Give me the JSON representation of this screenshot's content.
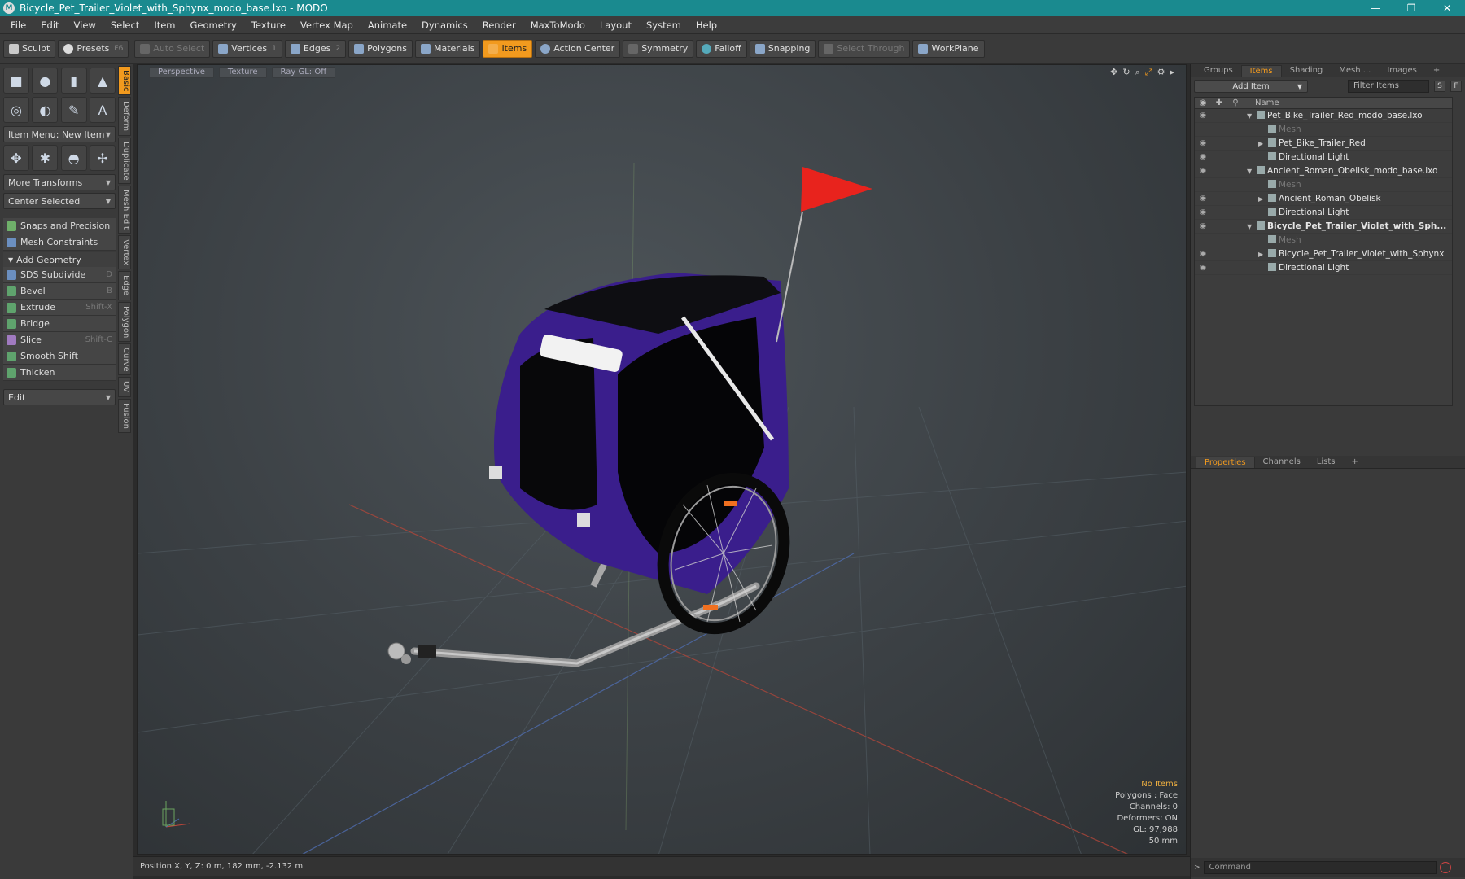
{
  "window": {
    "title": "Bicycle_Pet_Trailer_Violet_with_Sphynx_modo_base.lxo - MODO",
    "min": "—",
    "max": "❐",
    "close": "✕"
  },
  "menu": [
    "File",
    "Edit",
    "View",
    "Select",
    "Item",
    "Geometry",
    "Texture",
    "Vertex Map",
    "Animate",
    "Dynamics",
    "Render",
    "MaxToModo",
    "Layout",
    "System",
    "Help"
  ],
  "toolbar": {
    "sculpt": "Sculpt",
    "presets": "Presets",
    "presets_sc": "F6",
    "auto_select": "Auto Select",
    "vertices": "Vertices",
    "vertices_sc": "1",
    "edges": "Edges",
    "edges_sc": "2",
    "polygons": "Polygons",
    "materials": "Materials",
    "items": "Items",
    "action_center": "Action Center",
    "symmetry": "Symmetry",
    "falloff": "Falloff",
    "snapping": "Snapping",
    "select_through": "Select Through",
    "workplane": "WorkPlane"
  },
  "left": {
    "item_menu": "Item Menu: New Item",
    "more_transforms": "More Transforms",
    "center_selected": "Center Selected",
    "snaps": "Snaps and Precision",
    "mesh_constraints": "Mesh Constraints",
    "add_geometry": "Add Geometry",
    "tools": [
      {
        "label": "SDS Subdivide",
        "sc": "D"
      },
      {
        "label": "Bevel",
        "sc": "B"
      },
      {
        "label": "Extrude",
        "sc": "Shift-X"
      },
      {
        "label": "Bridge",
        "sc": ""
      },
      {
        "label": "Slice",
        "sc": "Shift-C"
      },
      {
        "label": "Smooth Shift",
        "sc": ""
      },
      {
        "label": "Thicken",
        "sc": ""
      }
    ],
    "edit": "Edit",
    "vtabs": [
      "Basic",
      "Deform",
      "Duplicate",
      "Mesh Edit",
      "Vertex",
      "Edge",
      "Polygon",
      "Curve",
      "UV",
      "Fusion"
    ]
  },
  "viewport": {
    "tabs": [
      "Perspective",
      "Texture",
      "Ray GL: Off"
    ],
    "info": {
      "selection": "No Items",
      "polygons": "Polygons : Face",
      "channels": "Channels: 0",
      "deformers": "Deformers: ON",
      "gl": "GL: 97,988",
      "scale": "50 mm"
    }
  },
  "status": {
    "position": "Position X, Y, Z:   0 m, 182 mm, -2.132 m"
  },
  "right": {
    "tabs": [
      "Groups",
      "Items",
      "Shading",
      "Mesh ...",
      "Images",
      "+"
    ],
    "add_item": "Add Item",
    "filter_items": "Filter Items",
    "s_btn": "S",
    "f_btn": "F",
    "name_col": "Name",
    "items": [
      {
        "label": "Pet_Bike_Trailer_Red_modo_base.lxo",
        "indent": 0,
        "exp": "▼",
        "dim": false,
        "bold": false
      },
      {
        "label": "Mesh",
        "indent": 1,
        "exp": "",
        "dim": true,
        "bold": false
      },
      {
        "label": "Pet_Bike_Trailer_Red",
        "indent": 1,
        "exp": "▶",
        "dim": false,
        "bold": false
      },
      {
        "label": "Directional Light",
        "indent": 1,
        "exp": "",
        "dim": false,
        "bold": false
      },
      {
        "label": "Ancient_Roman_Obelisk_modo_base.lxo",
        "indent": 0,
        "exp": "▼",
        "dim": false,
        "bold": false
      },
      {
        "label": "Mesh",
        "indent": 1,
        "exp": "",
        "dim": true,
        "bold": false
      },
      {
        "label": "Ancient_Roman_Obelisk",
        "indent": 1,
        "exp": "▶",
        "dim": false,
        "bold": false
      },
      {
        "label": "Directional Light",
        "indent": 1,
        "exp": "",
        "dim": false,
        "bold": false
      },
      {
        "label": "Bicycle_Pet_Trailer_Violet_with_Sph...",
        "indent": 0,
        "exp": "▼",
        "dim": false,
        "bold": true
      },
      {
        "label": "Mesh",
        "indent": 1,
        "exp": "",
        "dim": true,
        "bold": false
      },
      {
        "label": "Bicycle_Pet_Trailer_Violet_with_Sphynx",
        "indent": 1,
        "exp": "▶",
        "dim": false,
        "bold": false
      },
      {
        "label": "Directional Light",
        "indent": 1,
        "exp": "",
        "dim": false,
        "bold": false
      }
    ],
    "props_tabs": [
      "Properties",
      "Channels",
      "Lists",
      "+"
    ],
    "command_placeholder": "Command"
  },
  "colors": {
    "accent": "#f29a1e",
    "titlebar": "#1a8a8f",
    "trailer_violet": "#3a1e8c",
    "flag_red": "#e8231d"
  }
}
